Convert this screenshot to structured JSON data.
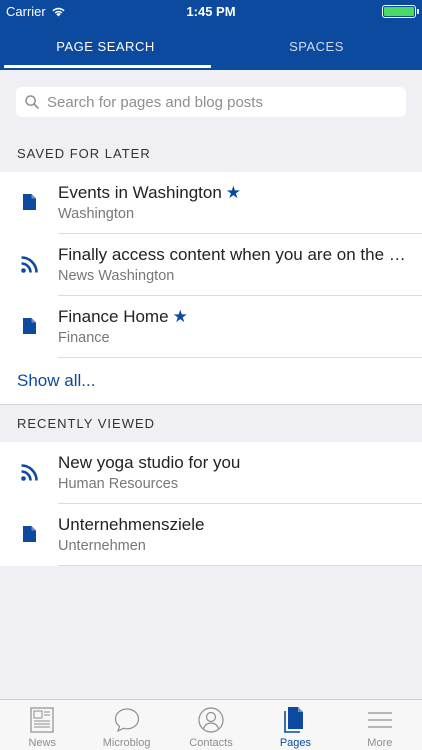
{
  "status_bar": {
    "carrier": "Carrier",
    "time": "1:45 PM",
    "battery_level": 1.0
  },
  "tabs": [
    {
      "label": "PAGE SEARCH",
      "active": true
    },
    {
      "label": "SPACES",
      "active": false
    }
  ],
  "search": {
    "placeholder": "Search for pages and blog posts"
  },
  "saved": {
    "header": "SAVED FOR LATER",
    "items": [
      {
        "icon": "page-icon",
        "title": "Events in Washington",
        "starred": true,
        "star": "★",
        "subtitle": "Washington"
      },
      {
        "icon": "rss-icon",
        "title": "Finally access content when you are on the move",
        "starred": false,
        "subtitle": "News Washington"
      },
      {
        "icon": "page-icon",
        "title": "Finance Home",
        "starred": true,
        "star": "★",
        "subtitle": "Finance"
      }
    ],
    "show_all": "Show all..."
  },
  "recent": {
    "header": "RECENTLY VIEWED",
    "items": [
      {
        "icon": "rss-icon",
        "title": "New yoga studio for you",
        "subtitle": "Human Resources"
      },
      {
        "icon": "page-icon",
        "title": "Unternehmensziele",
        "subtitle": "Unternehmen"
      }
    ]
  },
  "bottom_nav": [
    {
      "label": "News",
      "icon": "news-icon",
      "active": false
    },
    {
      "label": "Microblog",
      "icon": "speech-bubble-icon",
      "active": false
    },
    {
      "label": "Contacts",
      "icon": "person-icon",
      "active": false
    },
    {
      "label": "Pages",
      "icon": "pages-icon",
      "active": true
    },
    {
      "label": "More",
      "icon": "menu-icon",
      "active": false
    }
  ],
  "colors": {
    "brand": "#0b4a9e",
    "background": "#efeff4",
    "battery": "#4cd964"
  }
}
